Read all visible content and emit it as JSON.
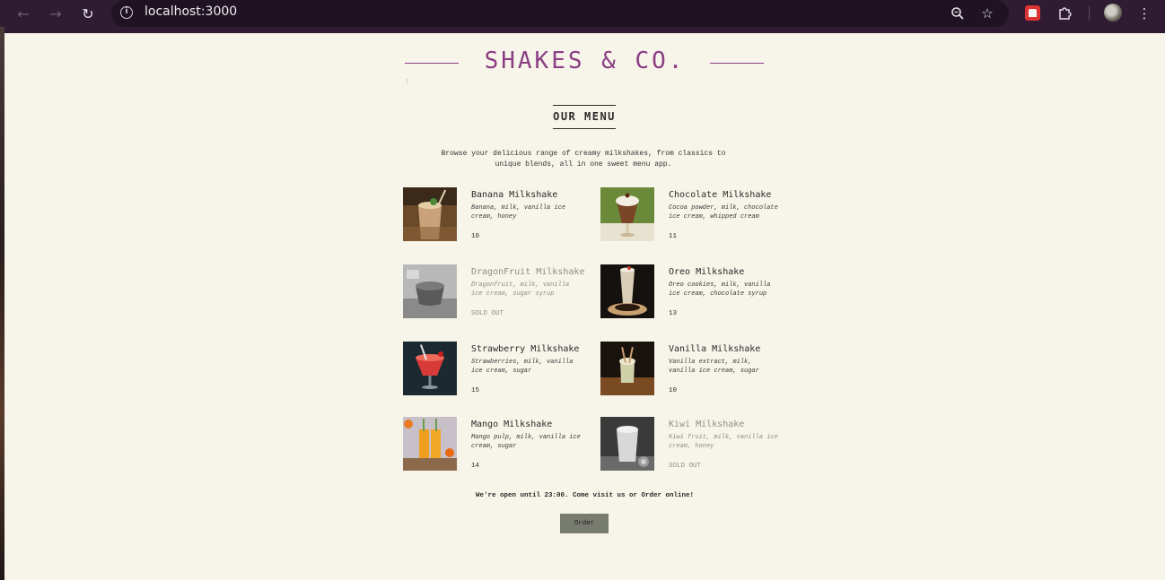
{
  "browser": {
    "url": "localhost:3000",
    "icons": {
      "back": "back-arrow-icon",
      "forward": "forward-arrow-icon",
      "reload": "reload-icon",
      "info": "site-info-icon",
      "zoom": "zoom-icon",
      "bookmark": "star-icon",
      "extensions": "puzzle-icon",
      "menu": "kebab-menu-icon"
    }
  },
  "header": {
    "brand": "SHAKES & CO."
  },
  "menu": {
    "title": "OUR MENU",
    "intro": "Browse your delicious range of creamy milkshakes, from classics to unique blends, all in one sweet menu app.",
    "items": [
      {
        "name": "Banana Milkshake",
        "ingredients": "Banana, milk, vanilla ice cream, honey",
        "price": "10",
        "sold_out": false
      },
      {
        "name": "Chocolate Milkshake",
        "ingredients": "Cocoa powder, milk, chocolate ice cream, whipped cream",
        "price": "11",
        "sold_out": false
      },
      {
        "name": "DragonFruit Milkshake",
        "ingredients": "Dragonfruit, milk, vanilla ice cream, sugar syrup",
        "price": "SOLD OUT",
        "sold_out": true
      },
      {
        "name": "Oreo Milkshake",
        "ingredients": "Oreo cookies, milk, vanilla ice cream, chocolate syrup",
        "price": "13",
        "sold_out": false
      },
      {
        "name": "Strawberry Milkshake",
        "ingredients": "Strawberries, milk, vanilla ice cream, sugar",
        "price": "15",
        "sold_out": false
      },
      {
        "name": "Vanilla Milkshake",
        "ingredients": "Vanilla extract, milk, vanilla ice cream, sugar",
        "price": "10",
        "sold_out": false
      },
      {
        "name": "Mango Milkshake",
        "ingredients": "Mango pulp, milk, vanilla ice cream, sugar",
        "price": "14",
        "sold_out": false
      },
      {
        "name": "Kiwi Milkshake",
        "ingredients": "Kiwi fruit, milk, vanilla ice cream, honey",
        "price": "SOLD OUT",
        "sold_out": true
      }
    ]
  },
  "footer": {
    "note": "We're open until 23:00. Come visit us or Order online!",
    "order_label": "Order"
  },
  "colors": {
    "brand": "#8b3e84",
    "background": "#f7f4ea",
    "button": "#787b70"
  }
}
